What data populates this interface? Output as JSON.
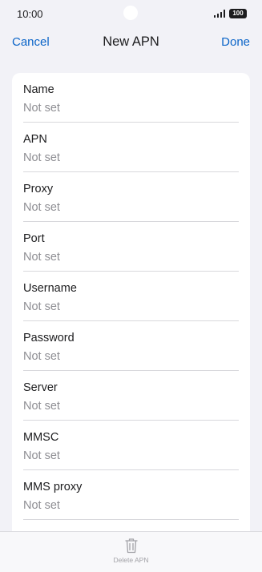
{
  "status_bar": {
    "time": "10:00",
    "battery": "100"
  },
  "nav": {
    "cancel": "Cancel",
    "title": "New APN",
    "done": "Done"
  },
  "fields": [
    {
      "label": "Name",
      "value": "Not set"
    },
    {
      "label": "APN",
      "value": "Not set"
    },
    {
      "label": "Proxy",
      "value": "Not set"
    },
    {
      "label": "Port",
      "value": "Not set"
    },
    {
      "label": "Username",
      "value": "Not set"
    },
    {
      "label": "Password",
      "value": "Not set"
    },
    {
      "label": "Server",
      "value": "Not set"
    },
    {
      "label": "MMSC",
      "value": "Not set"
    },
    {
      "label": "MMS proxy",
      "value": "Not set"
    }
  ],
  "toolbar": {
    "delete_label": "Delete APN",
    "delete_icon": "trash-icon"
  },
  "colors": {
    "accent": "#0a64c8",
    "background": "#f2f2f7",
    "placeholder": "#8e8e93",
    "disabled": "#a2a2a7"
  }
}
